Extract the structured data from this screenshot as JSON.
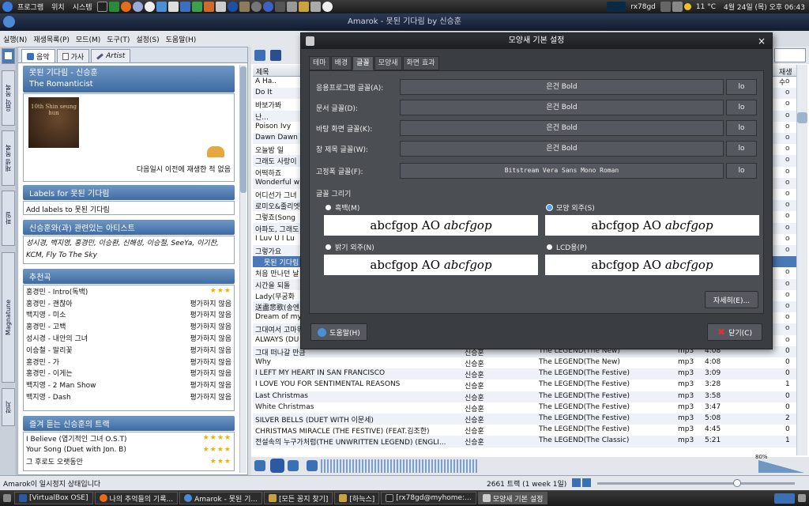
{
  "top_panel": {
    "menus": [
      "프로그램",
      "위치",
      "시스템"
    ],
    "tray_user": "rx78gd",
    "tray_temp": "11 °C",
    "clock": "4월 24일 (목) 오후 06:43"
  },
  "window_title": "Amarok - 못된 기다림 by 신승훈",
  "menubar": [
    "실행(N)",
    "재생목록(P)",
    "모드(M)",
    "도구(T)",
    "설정(S)",
    "도움말(H)"
  ],
  "vtabs": [
    "음악 목록",
    "재생 목록",
    "파일",
    "Magnatune",
    "장치"
  ],
  "context": {
    "tabs": [
      "음악",
      "가사",
      "Artist"
    ],
    "now_playing_title": "못된 기다림 - 신승훈",
    "album": "The Romanticist",
    "cover_text": "10th Shin seung hun",
    "last_played": "다음일시 이전에 재생한 적 없음",
    "labels_header": "Labels for 못된 기다림",
    "labels_add": "Add labels to 못된 기다림",
    "related_header": "신승훈와(과) 관련있는 아티스트",
    "related_text": "성시경, 백지영, 홍경민, 이승환, 신해성, 이승철, SeeYa, 이기찬, KCM, Fly To The Sky",
    "suggest_header": "추천곡",
    "suggest": [
      {
        "title": "홍경민 - Intro(독백)",
        "rating": "★★★"
      },
      {
        "title": "홍경민 - 괜찮아",
        "rating": "평가하지 않음"
      },
      {
        "title": "백지영 - 미소",
        "rating": "평가하지 않음"
      },
      {
        "title": "홍경민 - 고백",
        "rating": "평가하지 않음"
      },
      {
        "title": "성시경 - 내안의 그녀",
        "rating": "평가하지 않음"
      },
      {
        "title": "이승철 - 말리꽃",
        "rating": "평가하지 않음"
      },
      {
        "title": "홍경민 - 가",
        "rating": "평가하지 않음"
      },
      {
        "title": "홍경민 - 이게는",
        "rating": "평가하지 않음"
      },
      {
        "title": "백지영 - 2 Man Show",
        "rating": "평가하지 않음"
      },
      {
        "title": "백지영 - Dash",
        "rating": "평가하지 않음"
      }
    ],
    "fav_header": "즐겨 듣는 신승훈의 트랙",
    "favs": [
      {
        "title": "I Believe (엽기적인 그녀 O.S.T)",
        "rating": "★★★★"
      },
      {
        "title": "Your Song (Duet with Jon. B)",
        "rating": "★★★★"
      },
      {
        "title": "그 후로도 오랫동안",
        "rating": "★★★"
      }
    ]
  },
  "playlist": {
    "col_title": "제목",
    "col_play": "재생수",
    "rows_top": [
      "A Ha..",
      "Do It",
      "바보가봐",
      "난...",
      "Poison Ivy",
      "Dawn Dawn D",
      "오늘밤 일",
      "그래도 사랑이",
      "어떡하죠",
      "Wonderful w",
      "어디선가 그녀",
      "로미오&줄리엣",
      "그렇죠(Song ",
      "아파도, 그래도",
      "I Luv U I Lu",
      "그렇가요"
    ],
    "selected": "못된 기다림",
    "rows_mid": [
      "처음 만나던 날",
      "시간을 되돌",
      "Lady(무궁화 ",
      "送盡悲歌(송엔",
      "Dream of my",
      "그대여서 고마워",
      "ALWAYS (DU"
    ],
    "rows_full": [
      {
        "t": "그대 떠나갈 만큼",
        "a": "신승훈",
        "b": "The LEGEND(The New)",
        "f": "mp3",
        "d": "4:08",
        "p": "0"
      },
      {
        "t": "Why",
        "a": "신승훈",
        "b": "The LEGEND(The New)",
        "f": "mp3",
        "d": "4:08",
        "p": "0"
      },
      {
        "t": "I LEFT MY HEART IN SAN FRANCISCO",
        "a": "신승훈",
        "b": "The LEGEND(The Festive)",
        "f": "mp3",
        "d": "3:09",
        "p": "0"
      },
      {
        "t": "I LOVE YOU FOR SENTIMENTAL REASONS",
        "a": "신승훈",
        "b": "The LEGEND(The Festive)",
        "f": "mp3",
        "d": "3:28",
        "p": "1"
      },
      {
        "t": "Last Christmas",
        "a": "신승훈",
        "b": "The LEGEND(The Festive)",
        "f": "mp3",
        "d": "3:58",
        "p": "0"
      },
      {
        "t": "White Christmas",
        "a": "신승훈",
        "b": "The LEGEND(The Festive)",
        "f": "mp3",
        "d": "3:47",
        "p": "0"
      },
      {
        "t": "SILVER BELLS (DUET WITH 이문세)",
        "a": "신승훈",
        "b": "The LEGEND(The Festive)",
        "f": "mp3",
        "d": "5:08",
        "p": "2"
      },
      {
        "t": "CHRISTMAS MIRACLE (THE FESTIVE) (FEAT.김조한)",
        "a": "신승훈",
        "b": "The LEGEND(The Festive)",
        "f": "mp3",
        "d": "4:45",
        "p": "0"
      },
      {
        "t": "전설속의 누구가처럼(THE UNWRITTEN LEGEND) (ENGLI...",
        "a": "신승훈",
        "b": "The LEGEND(The Classic)",
        "f": "mp3",
        "d": "5:21",
        "p": "1"
      }
    ],
    "right_col": [
      "o",
      "o",
      "o",
      "o",
      "o",
      "o",
      "o",
      "o",
      "o",
      "o",
      "o",
      "o",
      "o",
      "o",
      "o",
      "o",
      "o",
      "o",
      "o",
      "o",
      "o",
      "o",
      "o",
      "o"
    ]
  },
  "dialog": {
    "title": "모양새 기본 설정",
    "tabs": [
      "테마",
      "배경",
      "글꼴",
      "모양새",
      "화면 효과"
    ],
    "fonts": [
      {
        "label": "응용프로그램 글꼴(A):",
        "value": "은건 Bold",
        "btn": "lo"
      },
      {
        "label": "문서 글꼴(D):",
        "value": "은건 Bold",
        "btn": "lo"
      },
      {
        "label": "바탕 화면 글꼴(K):",
        "value": "은건 Bold",
        "btn": "lo"
      },
      {
        "label": "창 제목 글꼴(W):",
        "value": "은건 Bold",
        "btn": "lo"
      },
      {
        "label": "고정폭 글꼴(F):",
        "value": "Bitstream Vera Sans Mono Roman",
        "btn": "lo"
      }
    ],
    "render_label": "글꼴 그리기",
    "render_opts": [
      "흑백(M)",
      "모양 외주(S)",
      "밝기 외주(N)",
      "LCD용(P)"
    ],
    "preview_text": "abcfgop AO ",
    "preview_italic": "abcfgop",
    "details_btn": "자세히(E)...",
    "help_btn": "도움말(H)",
    "close_btn": "닫기(C)"
  },
  "volume": "80%",
  "status": {
    "left": "Amarok이 일시정지 상태입니다",
    "tracks": "2661 트랙 (1 week 1일)"
  },
  "taskbar": [
    "[VirtualBox OSE]",
    "나의 추억들의 기록...",
    "Amarok - 못된 기...",
    "[모든 꽁지 찾기]",
    "[하늑스]",
    "[rx78gd@myhome:...",
    "모양새 기본 설정"
  ]
}
